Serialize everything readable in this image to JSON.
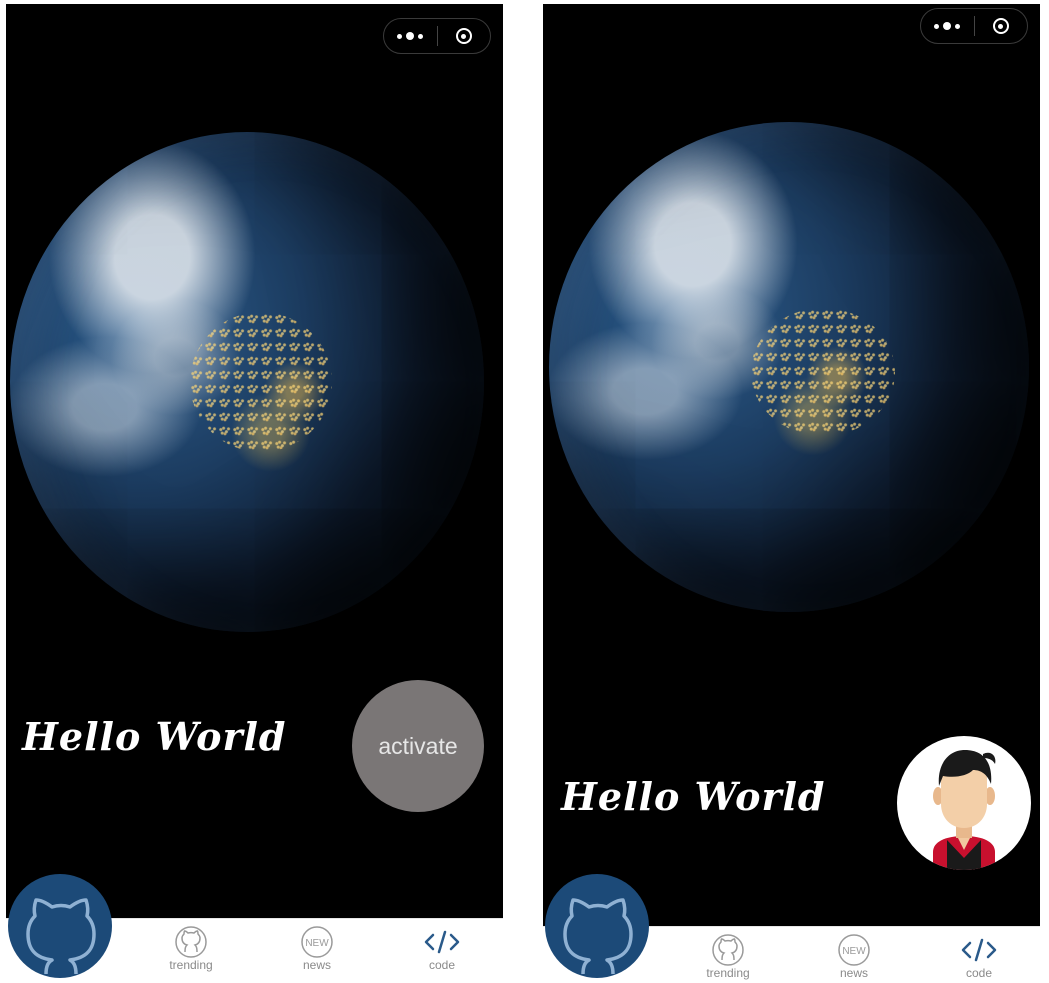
{
  "screens": [
    {
      "greeting": "Hello World",
      "action_button_label": "activate",
      "tabs": [
        {
          "label": "trending",
          "icon": "github-cat-icon"
        },
        {
          "label": "news",
          "icon": "new-badge-icon",
          "badge_text": "NEW"
        },
        {
          "label": "code",
          "icon": "code-brackets-icon"
        }
      ]
    },
    {
      "greeting": "Hello World",
      "tabs": [
        {
          "label": "trending",
          "icon": "github-cat-icon"
        },
        {
          "label": "news",
          "icon": "new-badge-icon",
          "badge_text": "NEW"
        },
        {
          "label": "code",
          "icon": "code-brackets-icon"
        }
      ]
    }
  ],
  "colors": {
    "screen_background": "#000000",
    "activate_button": "#7a7676",
    "home_fab": "#1c4a78",
    "tab_text": "#8a8a8a"
  }
}
